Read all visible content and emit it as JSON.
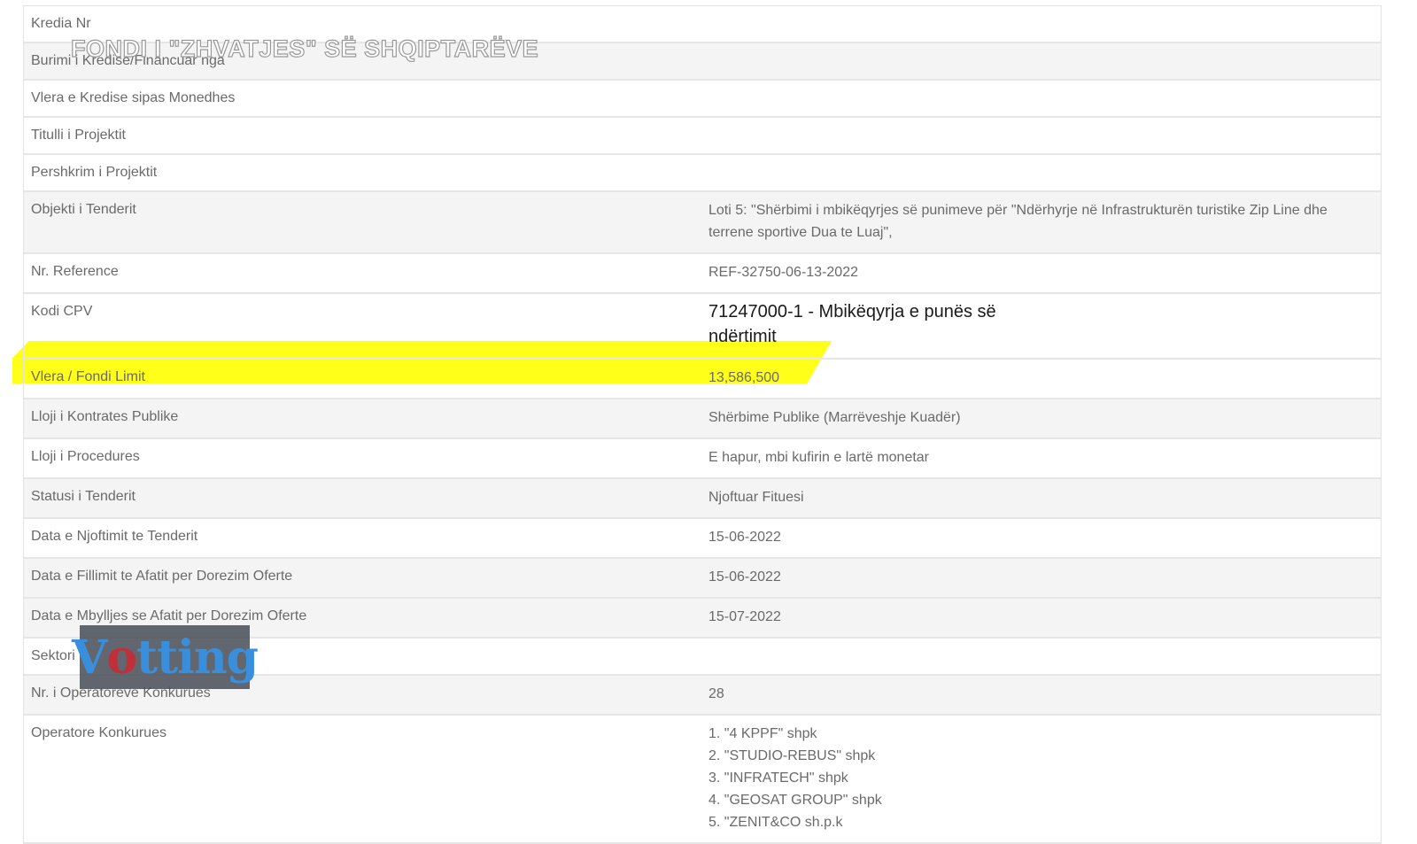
{
  "overlay_title": "FONDI I \"ZHVATJES\" SË SHQIPTARËVE",
  "logo_text": {
    "v": "V",
    "o": "o",
    "rest": "tting"
  },
  "rows": [
    {
      "label": "Kredia Nr",
      "value": ""
    },
    {
      "label": "Burimi i Kredise/Financuar nga",
      "value": ""
    },
    {
      "label": "Vlera e Kredise sipas Monedhes",
      "value": ""
    },
    {
      "label": "Titulli i Projektit",
      "value": ""
    },
    {
      "label": "Pershkrim i Projektit",
      "value": ""
    },
    {
      "label": "Objekti i Tenderit",
      "value": "Loti 5: \"Shërbimi i mbikëqyrjes së punimeve për \"Ndërhyrje në Infrastrukturën turistike Zip Line dhe terrene sportive Dua te Luaj\","
    },
    {
      "label": "Nr. Reference",
      "value": "REF-32750-06-13-2022"
    },
    {
      "label": "Kodi CPV",
      "value": "71247000-1 - Mbikëqyrja e punës së ndërtimit"
    },
    {
      "label": "Vlera / Fondi Limit",
      "value": "13,586,500"
    },
    {
      "label": "Lloji i Kontrates Publike",
      "value": "Shërbime Publike (Marrëveshje Kuadër)"
    },
    {
      "label": "Lloji i Procedures",
      "value": "E hapur, mbi kufirin e lartë monetar"
    },
    {
      "label": "Statusi i Tenderit",
      "value": "Njoftuar Fituesi"
    },
    {
      "label": "Data e Njoftimit te Tenderit",
      "value": "15-06-2022"
    },
    {
      "label": "Data e Fillimit te Afatit per Dorezim Oferte",
      "value": "15-06-2022"
    },
    {
      "label": "Data e Mbylljes se Afatit per Dorezim Oferte",
      "value": "15-07-2022"
    },
    {
      "label": "Sektori",
      "value": ""
    },
    {
      "label": "Nr. i Operatoreve Konkurues",
      "value": "28"
    },
    {
      "label": "Operatore Konkurues",
      "value": ""
    }
  ],
  "operators": [
    "1. \"4 KPPF\" shpk",
    "2. \"STUDIO-REBUS\" shpk",
    "3. \"INFRATECH\" shpk",
    "4. \"GEOSAT GROUP\" shpk",
    "5. \"ZENIT&CO sh.p.k"
  ],
  "highlight_color": "#ffff00"
}
